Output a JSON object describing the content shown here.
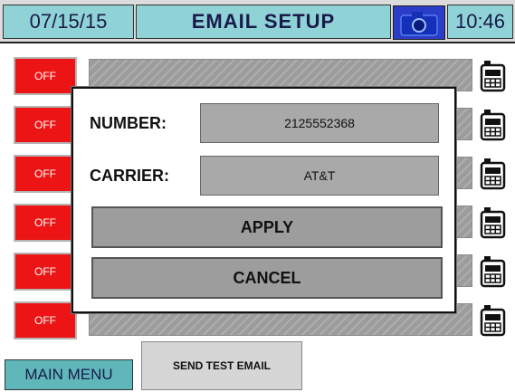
{
  "header": {
    "date": "07/15/15",
    "title": "EMAIL SETUP",
    "time": "10:46",
    "camera_icon": "camera-icon"
  },
  "rows": [
    {
      "toggle_label": "OFF"
    },
    {
      "toggle_label": "OFF"
    },
    {
      "toggle_label": "OFF"
    },
    {
      "toggle_label": "OFF"
    },
    {
      "toggle_label": "OFF"
    },
    {
      "toggle_label": "OFF"
    }
  ],
  "modal": {
    "number_label": "NUMBER:",
    "number_value": "2125552368",
    "carrier_label": "CARRIER:",
    "carrier_value": "AT&T",
    "apply_label": "APPLY",
    "cancel_label": "CANCEL"
  },
  "footer": {
    "main_menu_label": "MAIN MENU",
    "send_test_label": "SEND TEST EMAIL"
  },
  "colors": {
    "header_accent": "#8fd3d6",
    "off_button": "#ec1414",
    "camera_button": "#2a3cc8"
  }
}
